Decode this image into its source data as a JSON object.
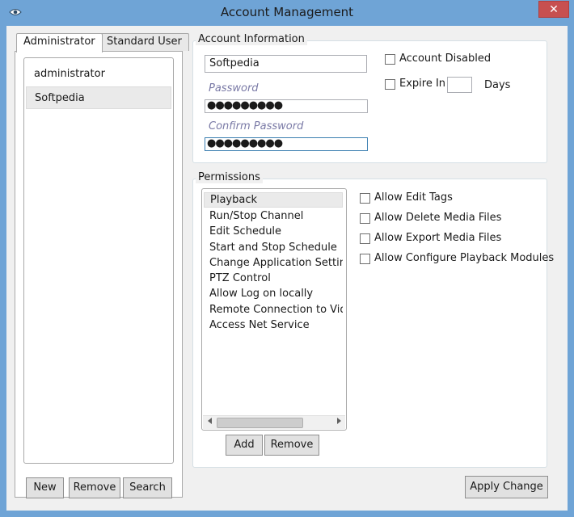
{
  "window": {
    "title": "Account Management",
    "close_glyph": "✕"
  },
  "tabs": [
    {
      "label": "Administrator",
      "active": true
    },
    {
      "label": "Standard User",
      "active": false
    }
  ],
  "users": [
    {
      "name": "administrator",
      "selected": false
    },
    {
      "name": "Softpedia",
      "selected": true
    }
  ],
  "user_buttons": {
    "new": "New",
    "remove": "Remove",
    "search": "Search"
  },
  "account_info": {
    "group_label": "Account Information",
    "username": "Softpedia",
    "password_label": "Password",
    "password_value": "●●●●●●●●●",
    "confirm_label": "Confirm Password",
    "confirm_value": "●●●●●●●●●",
    "account_disabled_label": "Account Disabled",
    "account_disabled_checked": false,
    "expire_in_label": "Expire In",
    "expire_in_checked": false,
    "expire_days_value": "",
    "days_label": "Days"
  },
  "permissions": {
    "group_label": "Permissions",
    "items": [
      "Playback",
      "Run/Stop Channel",
      "Edit Schedule",
      "Start and Stop Schedule",
      "Change Application Setting",
      "PTZ Control",
      "Allow Log on locally",
      "Remote Connection to Video",
      "Access Net Service"
    ],
    "selected_index": 0,
    "checks": [
      {
        "label": "Allow Edit Tags",
        "checked": false
      },
      {
        "label": "Allow Delete Media Files",
        "checked": false
      },
      {
        "label": "Allow Export Media Files",
        "checked": false
      },
      {
        "label": "Allow Configure Playback Modules",
        "checked": false
      }
    ],
    "add_label": "Add",
    "remove_label": "Remove"
  },
  "apply_label": "Apply Change",
  "icons": {
    "app": "eye-icon",
    "close": "close-icon",
    "scroll_left": "chevron-left-icon",
    "scroll_right": "chevron-right-icon"
  },
  "colors": {
    "titlebar": "#6fa4d6",
    "close": "#c75050",
    "client": "#f0f0f0",
    "placeholder": "#7a7aa6"
  }
}
